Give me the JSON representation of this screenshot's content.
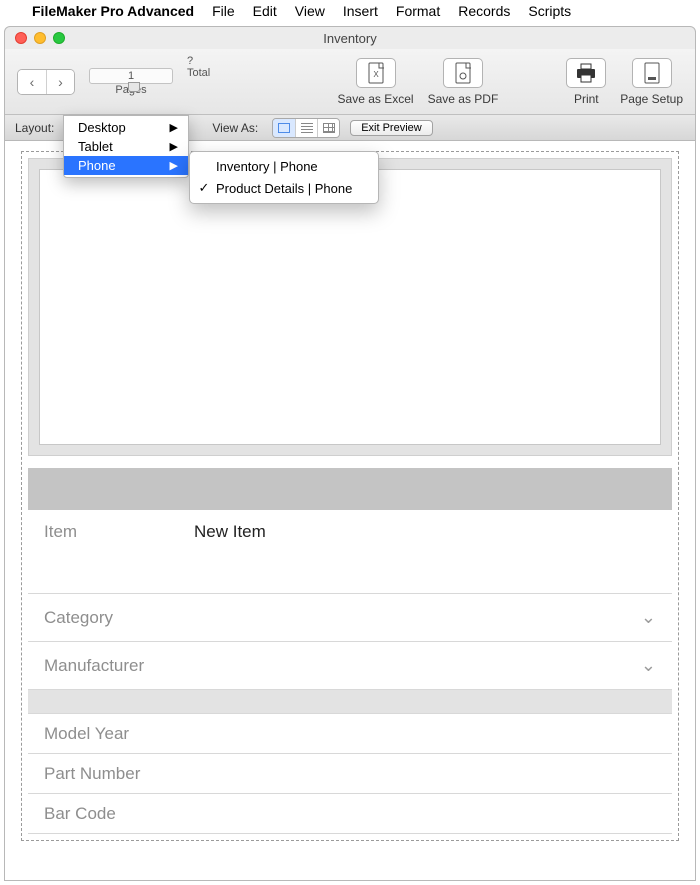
{
  "menubar": {
    "app": "FileMaker Pro Advanced",
    "items": [
      "File",
      "Edit",
      "View",
      "Insert",
      "Format",
      "Records",
      "Scripts"
    ]
  },
  "window": {
    "title": "Inventory"
  },
  "toolbar": {
    "page_value": "1",
    "pages_label": "Pages",
    "total_q": "?",
    "total_label": "Total",
    "save_excel": "Save as Excel",
    "save_pdf": "Save as PDF",
    "print": "Print",
    "page_setup": "Page Setup"
  },
  "layoutbar": {
    "layout_label": "Layout:",
    "viewas_label": "View As:",
    "exit_preview": "Exit Preview"
  },
  "layout_menu": {
    "items": [
      {
        "label": "Desktop",
        "selected": false
      },
      {
        "label": "Tablet",
        "selected": false
      },
      {
        "label": "Phone",
        "selected": true
      }
    ]
  },
  "submenu": {
    "items": [
      {
        "label": "Inventory | Phone",
        "checked": false
      },
      {
        "label": "Product Details | Phone",
        "checked": true
      }
    ]
  },
  "form": {
    "item_label": "Item",
    "item_value": "New Item",
    "category_label": "Category",
    "manufacturer_label": "Manufacturer",
    "model_year_label": "Model Year",
    "part_number_label": "Part Number",
    "bar_code_label": "Bar Code"
  }
}
